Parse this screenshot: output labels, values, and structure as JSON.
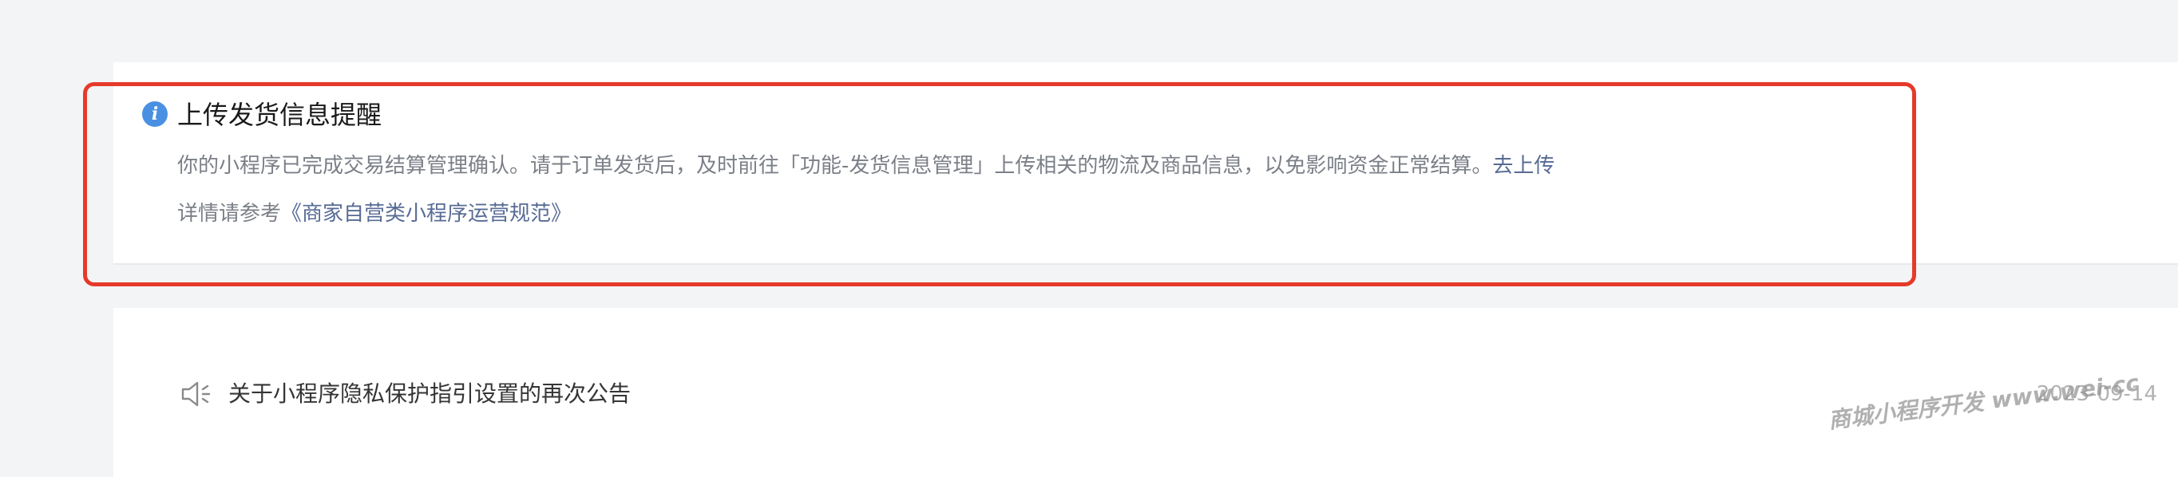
{
  "notice": {
    "icon": "info-icon",
    "icon_glyph": "i",
    "title": "上传发货信息提醒",
    "line1_text": "你的小程序已完成交易结算管理确认。请于订单发货后，及时前往「功能-发货信息管理」上传相关的物流及商品信息，以免影响资金正常结算。",
    "line1_link": "去上传",
    "line2_text": "详情请参考",
    "line2_link": "《商家自营类小程序运营规范》"
  },
  "announcement": {
    "icon": "speaker-icon",
    "text": "关于小程序隐私保护指引设置的再次公告",
    "date": "2023-09-14"
  },
  "watermark": {
    "text": "商城小程序开发 www.wei-cc"
  },
  "colors": {
    "link": "#576b95",
    "highlight": "#e53a2a",
    "info_icon": "#4a90e2"
  }
}
